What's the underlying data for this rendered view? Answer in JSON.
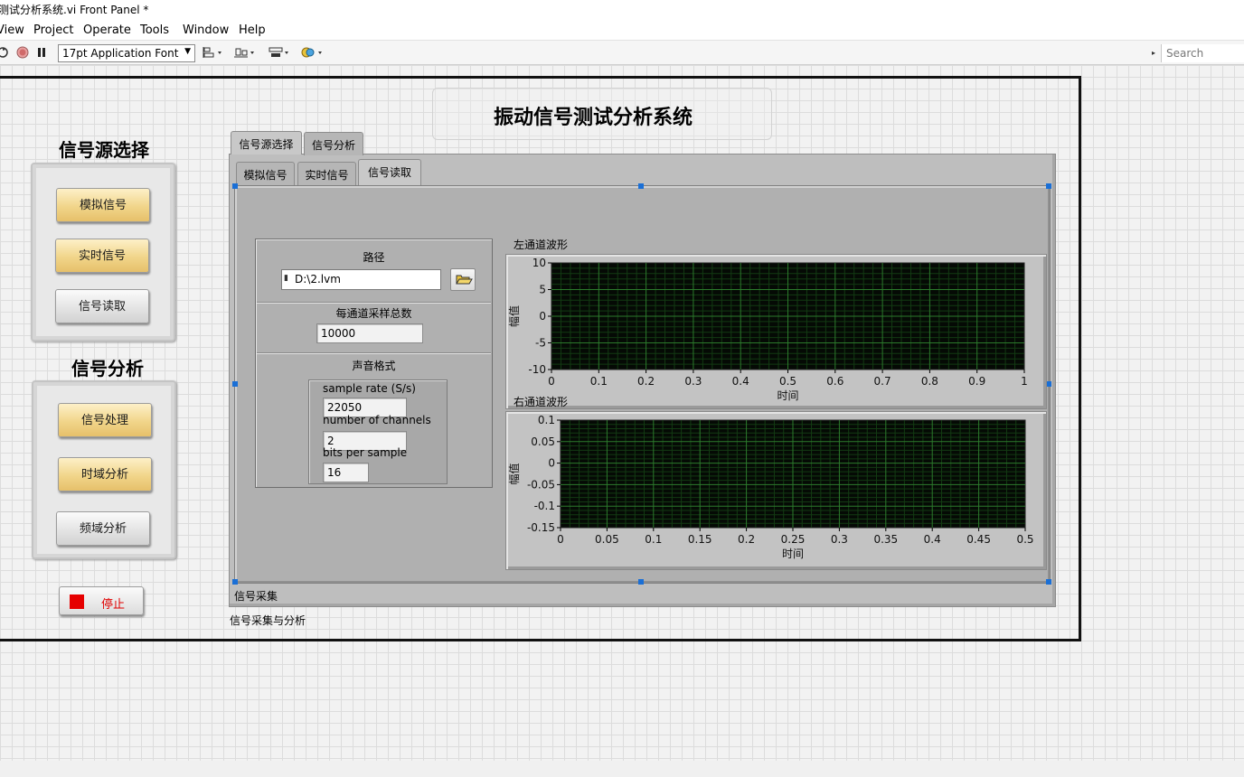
{
  "window": {
    "title": "测试分析系统.vi Front Panel *"
  },
  "menu": [
    "View",
    "Project",
    "Operate",
    "Tools",
    "Window",
    "Help"
  ],
  "toolbar": {
    "font": "17pt Application Font",
    "search_placeholder": "Search"
  },
  "panel": {
    "title": "振动信号测试分析系统",
    "source_section": "信号源选择",
    "source_buttons": [
      "模拟信号",
      "实时信号",
      "信号读取"
    ],
    "analysis_section": "信号分析",
    "analysis_buttons": [
      "信号处理",
      "时域分析",
      "频域分析"
    ],
    "stop_label": "停止"
  },
  "tabs": {
    "outer": [
      "信号源选择",
      "信号分析"
    ],
    "inner": [
      "模拟信号",
      "实时信号",
      "信号读取"
    ],
    "inner_caption": "信号采集",
    "outer_caption": "信号采集与分析"
  },
  "file": {
    "path_label": "路径",
    "path_value": "D:\\2.lvm",
    "samples_label": "每通道采样总数",
    "samples_value": "10000",
    "format_label": "声音格式",
    "sample_rate_label": "sample rate (S/s)",
    "sample_rate_value": "22050",
    "channels_label": "number of channels",
    "channels_value": "2",
    "bits_label": "bits per sample",
    "bits_value": "16"
  },
  "chart_data": [
    {
      "type": "line",
      "title": "左通道波形",
      "xlabel": "时间",
      "ylabel": "幅值",
      "xlim": [
        0,
        1
      ],
      "ylim": [
        -10,
        10
      ],
      "x_ticks": [
        "0",
        "0.1",
        "0.2",
        "0.3",
        "0.4",
        "0.5",
        "0.6",
        "0.7",
        "0.8",
        "0.9",
        "1"
      ],
      "y_ticks": [
        "10",
        "5",
        "0",
        "-5",
        "-10"
      ],
      "grid": true,
      "series": []
    },
    {
      "type": "line",
      "title": "右通道波形",
      "xlabel": "时间",
      "ylabel": "幅值",
      "xlim": [
        0,
        0.5
      ],
      "ylim": [
        -0.15,
        0.1
      ],
      "x_ticks": [
        "0",
        "0.05",
        "0.1",
        "0.15",
        "0.2",
        "0.25",
        "0.3",
        "0.35",
        "0.4",
        "0.45",
        "0.5"
      ],
      "y_ticks": [
        "0.1",
        "0.05",
        "0",
        "-0.05",
        "-0.1",
        "-0.15"
      ],
      "grid": true,
      "series": []
    }
  ]
}
